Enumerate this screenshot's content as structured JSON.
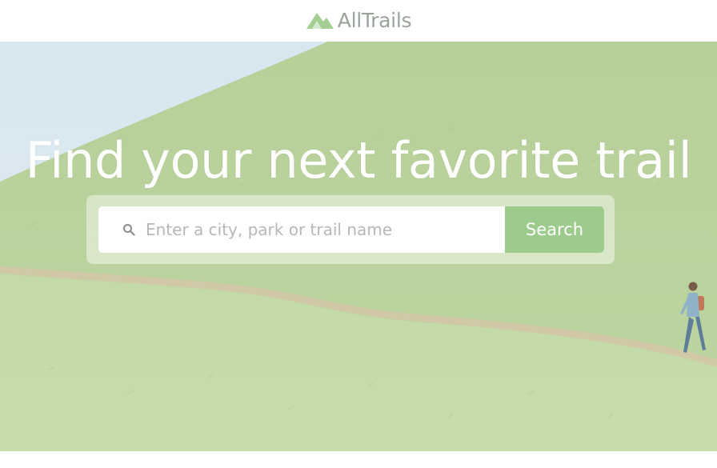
{
  "header": {
    "logo_text": "AllTrails",
    "logo_icon": "mountain-logo-icon"
  },
  "hero": {
    "headline": "Find your next favorite trail",
    "background": "hillside-trail-hiker-photo"
  },
  "search": {
    "placeholder": "Enter a city, park or trail name",
    "value": "",
    "button_label": "Search",
    "icon": "search-icon"
  },
  "colors": {
    "brand_green": "#9ccb8c",
    "logo_gray": "#9aa39a",
    "grass": "#b9d49c"
  }
}
